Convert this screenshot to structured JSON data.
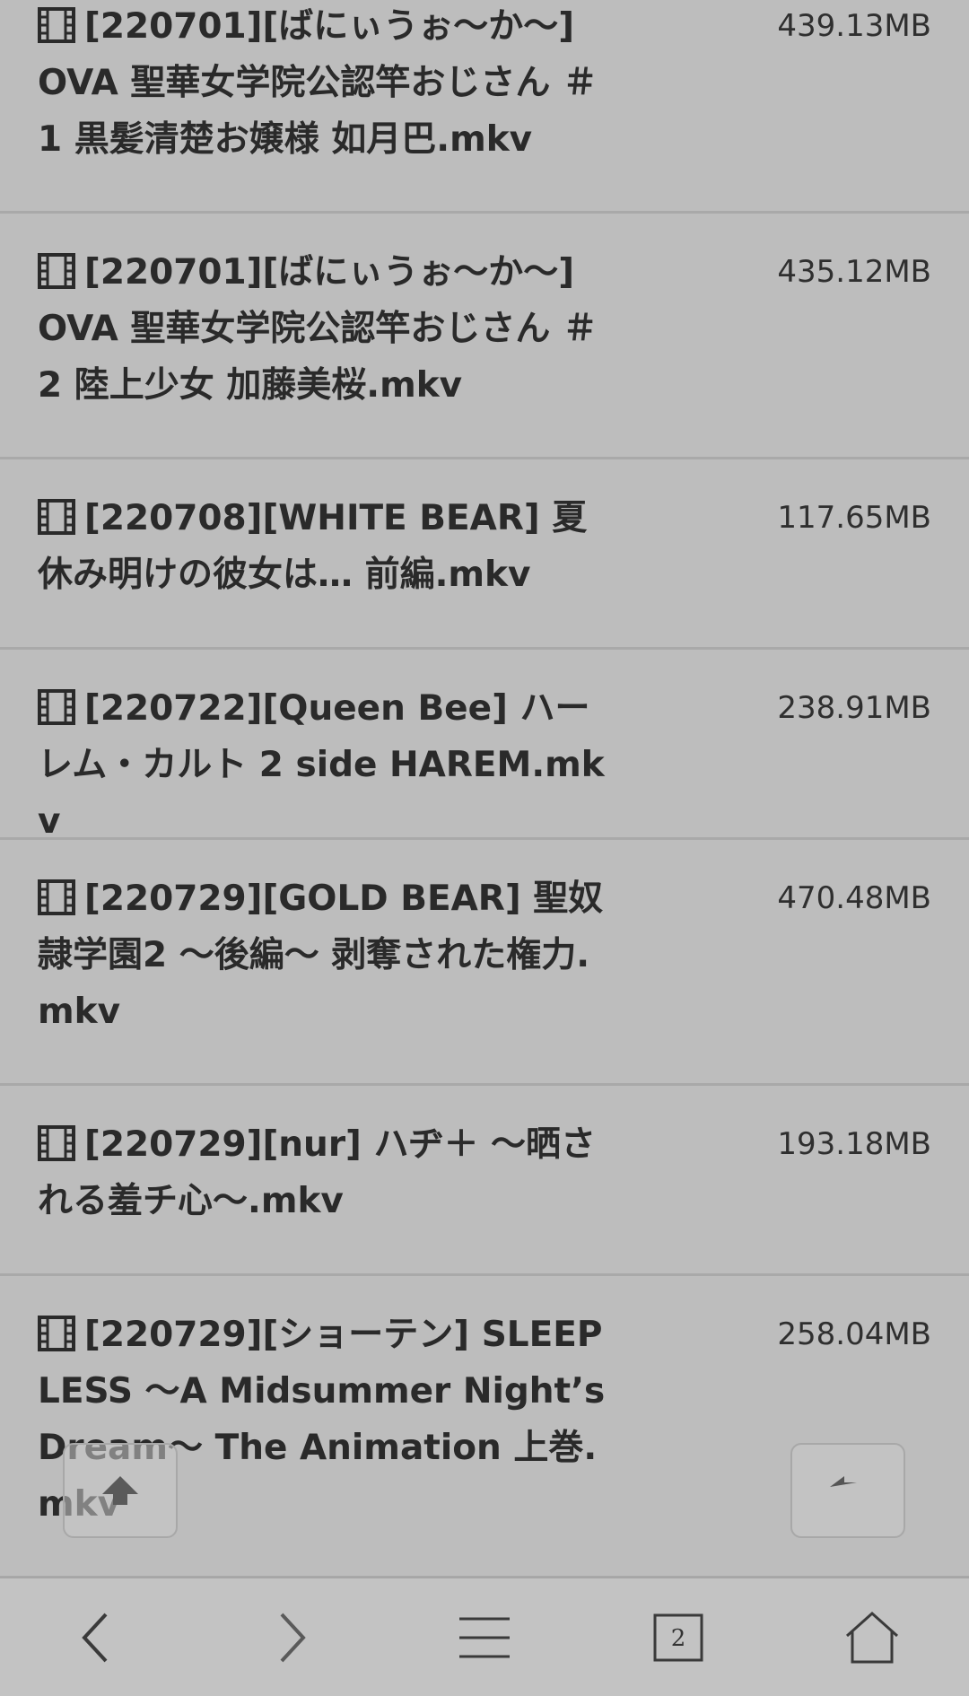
{
  "files": [
    {
      "name": "[220701][ばにぃうぉ〜か〜] OVA 聖華女学院公認竿おじさん ＃1 黒髪清楚お嬢様 如月巴.mkv",
      "size": "439.13MB"
    },
    {
      "name": "[220701][ばにぃうぉ〜か〜] OVA 聖華女学院公認竿おじさん ＃2 陸上少女 加藤美桜.mkv",
      "size": "435.12MB"
    },
    {
      "name": "[220708][WHITE BEAR] 夏休み明けの彼女は… 前編.mkv",
      "size": "117.65MB"
    },
    {
      "name": "[220722][Queen Bee] ハーレム・カルト 2 side HAREM.mkv",
      "size": "238.91MB"
    },
    {
      "name": "[220729][GOLD BEAR] 聖奴隷学園2 〜後編〜 剥奪された権力.mkv",
      "size": "470.48MB"
    },
    {
      "name": "[220729][nur] ハヂ＋ 〜晒される羞チ心〜.mkv",
      "size": "193.18MB"
    },
    {
      "name": "[220729][ショーテン] SLEEPLESS 〜A Midsummer Night’s Dream〜 The Animation 上巻.mkv",
      "size": "258.04MB"
    }
  ],
  "icons": {
    "file": "film-icon",
    "scroll_top": "arrow-up-icon",
    "back_float": "reply-arrow-icon",
    "nav_back": "chevron-left-icon",
    "nav_forward": "chevron-right-icon",
    "nav_menu": "hamburger-menu-icon",
    "nav_tabs": "tabs-icon",
    "nav_home": "home-icon"
  },
  "bottom_nav": {
    "tab_count": "2"
  },
  "colors": {
    "background": "#bfbfbf",
    "text": "#2b2b2b",
    "divider": "#a9a9a9"
  }
}
